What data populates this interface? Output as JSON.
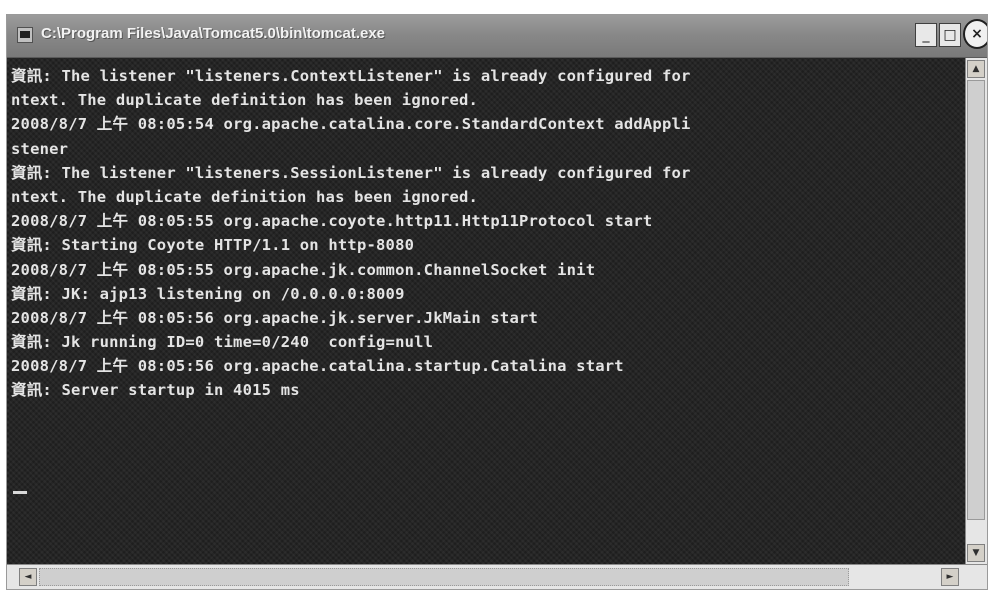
{
  "window": {
    "title": "C:\\Program Files\\Java\\Tomcat5.0\\bin\\tomcat.exe",
    "minimize_symbol": "_",
    "maximize_symbol": "□",
    "close_symbol": "×"
  },
  "console": {
    "lines": [
      "資訊: The listener \"listeners.ContextListener\" is already configured for",
      "ntext. The duplicate definition has been ignored.",
      "2008/8/7 上午 08:05:54 org.apache.catalina.core.StandardContext addAppli",
      "stener",
      "資訊: The listener \"listeners.SessionListener\" is already configured for",
      "ntext. The duplicate definition has been ignored.",
      "2008/8/7 上午 08:05:55 org.apache.coyote.http11.Http11Protocol start",
      "資訊: Starting Coyote HTTP/1.1 on http-8080",
      "2008/8/7 上午 08:05:55 org.apache.jk.common.ChannelSocket init",
      "資訊: JK: ajp13 listening on /0.0.0.0:8009",
      "2008/8/7 上午 08:05:56 org.apache.jk.server.JkMain start",
      "資訊: Jk running ID=0 time=0/240  config=null",
      "2008/8/7 上午 08:05:56 org.apache.catalina.startup.Catalina start",
      "資訊: Server startup in 4015 ms"
    ]
  },
  "scrollbars": {
    "up_arrow": "▲",
    "down_arrow": "▼",
    "left_arrow": "◄",
    "right_arrow": "►"
  }
}
